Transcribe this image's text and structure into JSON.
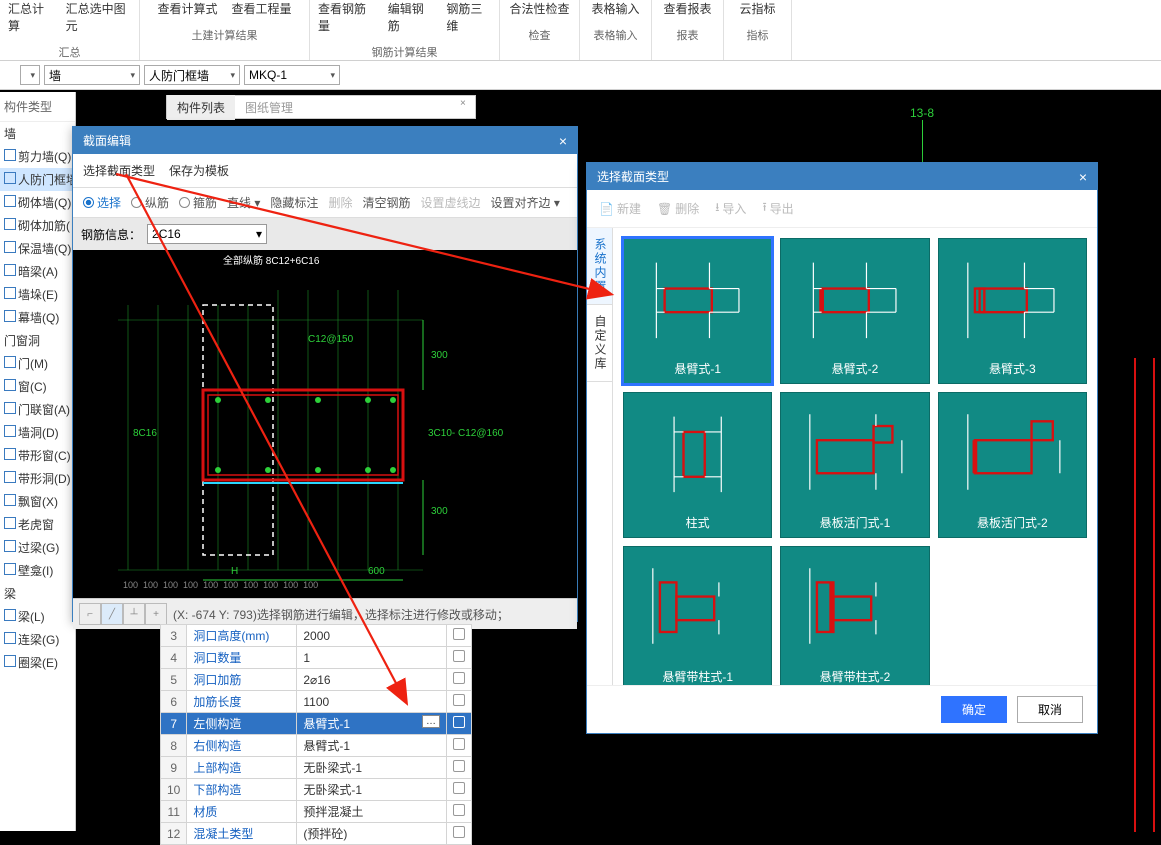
{
  "ribbon": {
    "groups": [
      {
        "label": "汇总",
        "items": [
          "汇总计算",
          "汇总选中图元"
        ]
      },
      {
        "label": "土建计算结果",
        "items": [
          "查看计算式",
          "查看工程量"
        ]
      },
      {
        "label": "钢筋计算结果",
        "items": [
          "查看钢筋量",
          "编辑钢筋",
          "钢筋三维"
        ]
      },
      {
        "label": "检查",
        "items": [
          "合法性检查"
        ]
      },
      {
        "label": "表格输入",
        "items": [
          "表格输入"
        ]
      },
      {
        "label": "报表",
        "items": [
          "查看报表"
        ]
      },
      {
        "label": "指标",
        "items": [
          "云指标"
        ]
      }
    ]
  },
  "dropdowns": {
    "d1": "墙",
    "d2": "人防门框墙",
    "d3": "MKQ-1"
  },
  "left_panel": {
    "title": "  构件类型",
    "group_wall": "墙",
    "wall_items": [
      "剪力墙(Q)",
      "人防门框墙",
      "砌体墙(Q)",
      "砌体加筋(",
      "保温墙(Q)",
      "暗梁(A)",
      "墙垛(E)",
      "幕墙(Q)"
    ],
    "group_open": "门窗洞",
    "open_items": [
      "门(M)",
      "窗(C)",
      "门联窗(A)",
      "墙洞(D)",
      "带形窗(C)",
      "带形洞(D)",
      "飘窗(X)",
      "老虎窗",
      "过梁(G)",
      "壁龛(I)"
    ],
    "group_beam": "梁",
    "beam_items": [
      "梁(L)",
      "连梁(G)",
      "圈梁(E)"
    ]
  },
  "center_tabs": {
    "t1": "构件列表",
    "t2": "图纸管理"
  },
  "dlg1": {
    "title": "截面编辑",
    "menu": {
      "select_type": "选择截面类型",
      "save_tpl": "保存为模板"
    },
    "toolbar": {
      "select": "选择",
      "long": "纵筋",
      "stirrup": "箍筋",
      "line": "直线",
      "hide": "隐藏标注",
      "delete": "删除",
      "clear": "清空钢筋",
      "dashed": "设置虚线边",
      "align": "设置对齐边"
    },
    "rebar_info_lbl": "钢筋信息：",
    "rebar_info_val": "2C16",
    "canvas_note": "全部纵筋 8C12+6C16",
    "cad_label_mid": "C12@150",
    "cad_label_8c16": "8C16",
    "cad_label_right": "3C10- C12@160",
    "cad_dim300": "300",
    "cad_dim600": "600",
    "cad_bottom": "H",
    "cad_tick": "100",
    "status_text": "(X: -674 Y: 793)选择钢筋进行编辑，选择标注进行修改或移动；"
  },
  "props": {
    "rows": [
      {
        "n": "3",
        "lbl": "洞口高度(mm)",
        "val": "2000"
      },
      {
        "n": "4",
        "lbl": "洞口数量",
        "val": "1"
      },
      {
        "n": "5",
        "lbl": "洞口加筋",
        "val": "2⌀16"
      },
      {
        "n": "6",
        "lbl": "加筋长度",
        "val": "1100"
      },
      {
        "n": "7",
        "lbl": "左侧构造",
        "val": "悬臂式-1"
      },
      {
        "n": "8",
        "lbl": "右侧构造",
        "val": "悬臂式-1"
      },
      {
        "n": "9",
        "lbl": "上部构造",
        "val": "无卧梁式-1"
      },
      {
        "n": "10",
        "lbl": "下部构造",
        "val": "无卧梁式-1"
      },
      {
        "n": "11",
        "lbl": "材质",
        "val": "预拌混凝土"
      },
      {
        "n": "12",
        "lbl": "混凝土类型",
        "val": "(预拌砼)"
      }
    ]
  },
  "dlg2": {
    "title": "选择截面类型",
    "toolbar": {
      "new": "新建",
      "del": "删除",
      "import": "导入",
      "export": "导出"
    },
    "vtabs": {
      "sys": "系统内置",
      "custom": "自定义库"
    },
    "tiles": [
      "悬臂式-1",
      "悬臂式-2",
      "悬臂式-3",
      "柱式",
      "悬板活门式-1",
      "悬板活门式-2",
      "悬臂带柱式-1",
      "悬臂带柱式-2"
    ],
    "ok": "确定",
    "cancel": "取消"
  },
  "viewport": {
    "marker": "13-8"
  }
}
